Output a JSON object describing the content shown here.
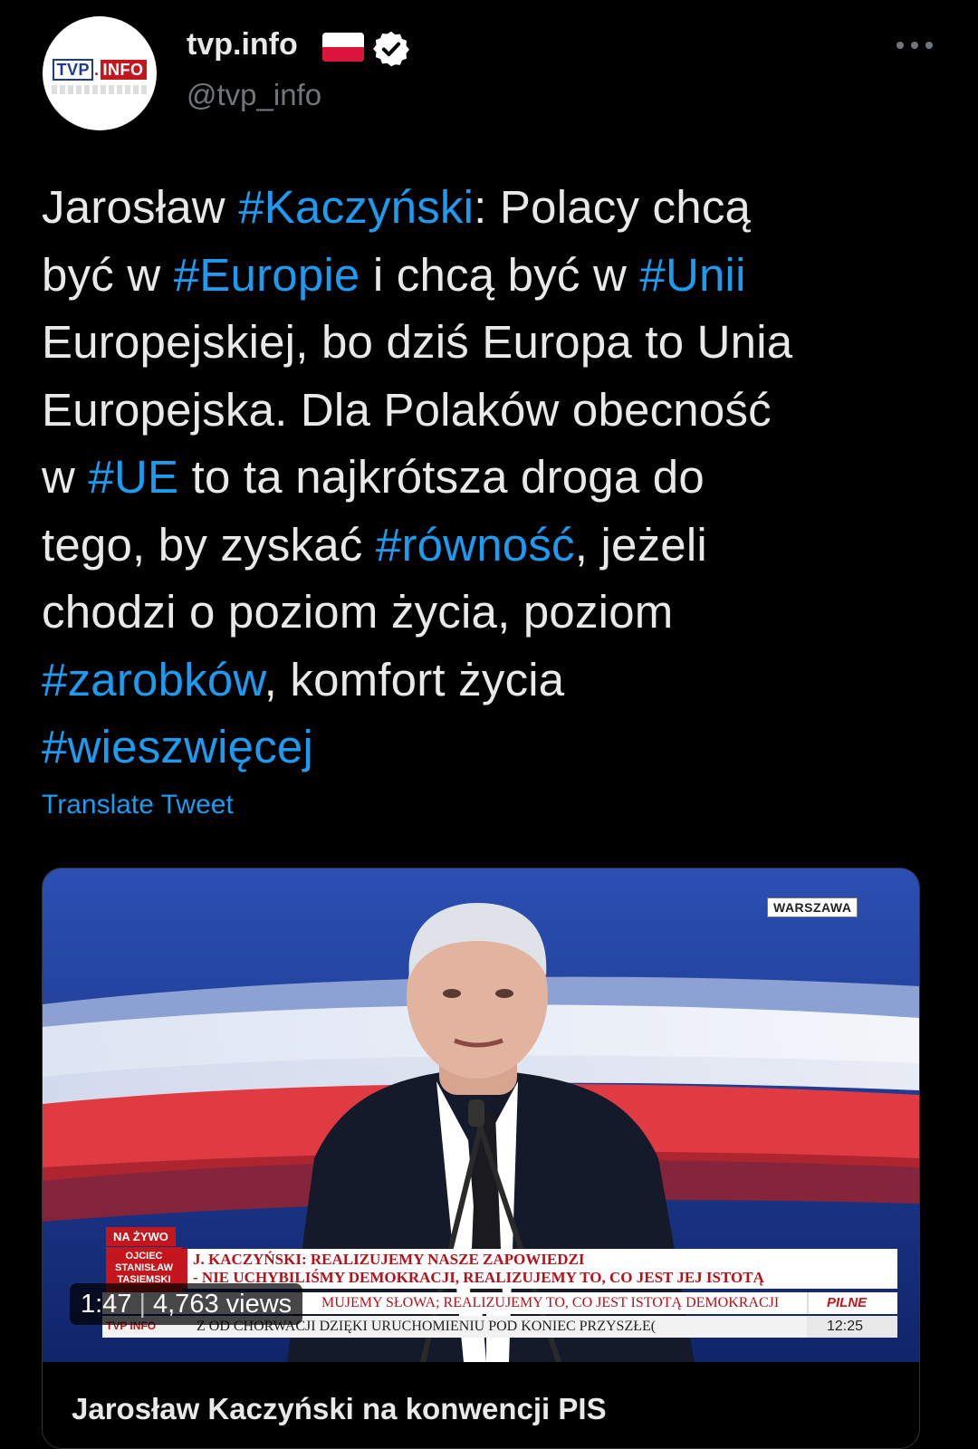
{
  "account": {
    "display_name": "tvp.info",
    "handle": "@tvp_info",
    "avatar_logo": {
      "tvp": "TVP",
      "info": "INFO"
    },
    "flag_icon": "poland-flag-icon",
    "verified_icon": "verified-badge-icon",
    "more_icon": "more-options-icon"
  },
  "tweet": {
    "segments": [
      {
        "text": "Jarosław ",
        "tag": false
      },
      {
        "text": "#Kaczyński",
        "tag": true
      },
      {
        "text": ": Polacy chcą\nbyć w ",
        "tag": false
      },
      {
        "text": "#Europie",
        "tag": true
      },
      {
        "text": " i chcą być w ",
        "tag": false
      },
      {
        "text": "#Unii",
        "tag": true
      },
      {
        "text": "\nEuropejskiej, bo dziś Europa to Unia\nEuropejska. Dla Polaków obecność\nw ",
        "tag": false
      },
      {
        "text": "#UE",
        "tag": true
      },
      {
        "text": " to ta najkrótsza droga do\ntego, by zyskać ",
        "tag": false
      },
      {
        "text": "#równość",
        "tag": true
      },
      {
        "text": ", jeżeli\nchodzi o poziom życia, poziom\n",
        "tag": false
      },
      {
        "text": "#zarobków",
        "tag": true
      },
      {
        "text": ", komfort życia\n",
        "tag": false
      },
      {
        "text": "#wieszwięcej",
        "tag": true
      }
    ],
    "translate_label": "Translate Tweet"
  },
  "media": {
    "location_badge": "WARSZAWA",
    "live_badge": "NA ŻYWO",
    "name_box": "OJCIEC STANISŁAW TASIEMSKI",
    "headline_line1": "J. KACZYŃSKI: REALIZUJEMY NASZE ZAPOWIEDZI",
    "headline_line2": "- NIE UCHYBILIŚMY DEMOKRACJI, REALIZUJEMY TO, CO JEST JEJ ISTOTĄ",
    "ticker_line1": "MUJEMY SŁOWA; REALIZUJEMY TO, CO JEST ISTOTĄ DEMOKRACJI",
    "ticker_pilne": "PILNE",
    "ticker_line2": "Z OD CHORWACJI DZIĘKI URUCHOMIENIU POD KONIEC PRZYSZŁE(",
    "ticker_clock": "12:25",
    "channel_mini": "TVP INFO",
    "duration": "1:47",
    "separator": "|",
    "views": "4,763 views",
    "card_title": "Jarosław Kaczyński na konwencji PIS"
  },
  "colors": {
    "background": "#000000",
    "text": "#e7e9ea",
    "secondary_text": "#71767b",
    "link": "#1d9bf0",
    "verified_badge": "#ffffff",
    "tvp_red": "#c4161c"
  }
}
